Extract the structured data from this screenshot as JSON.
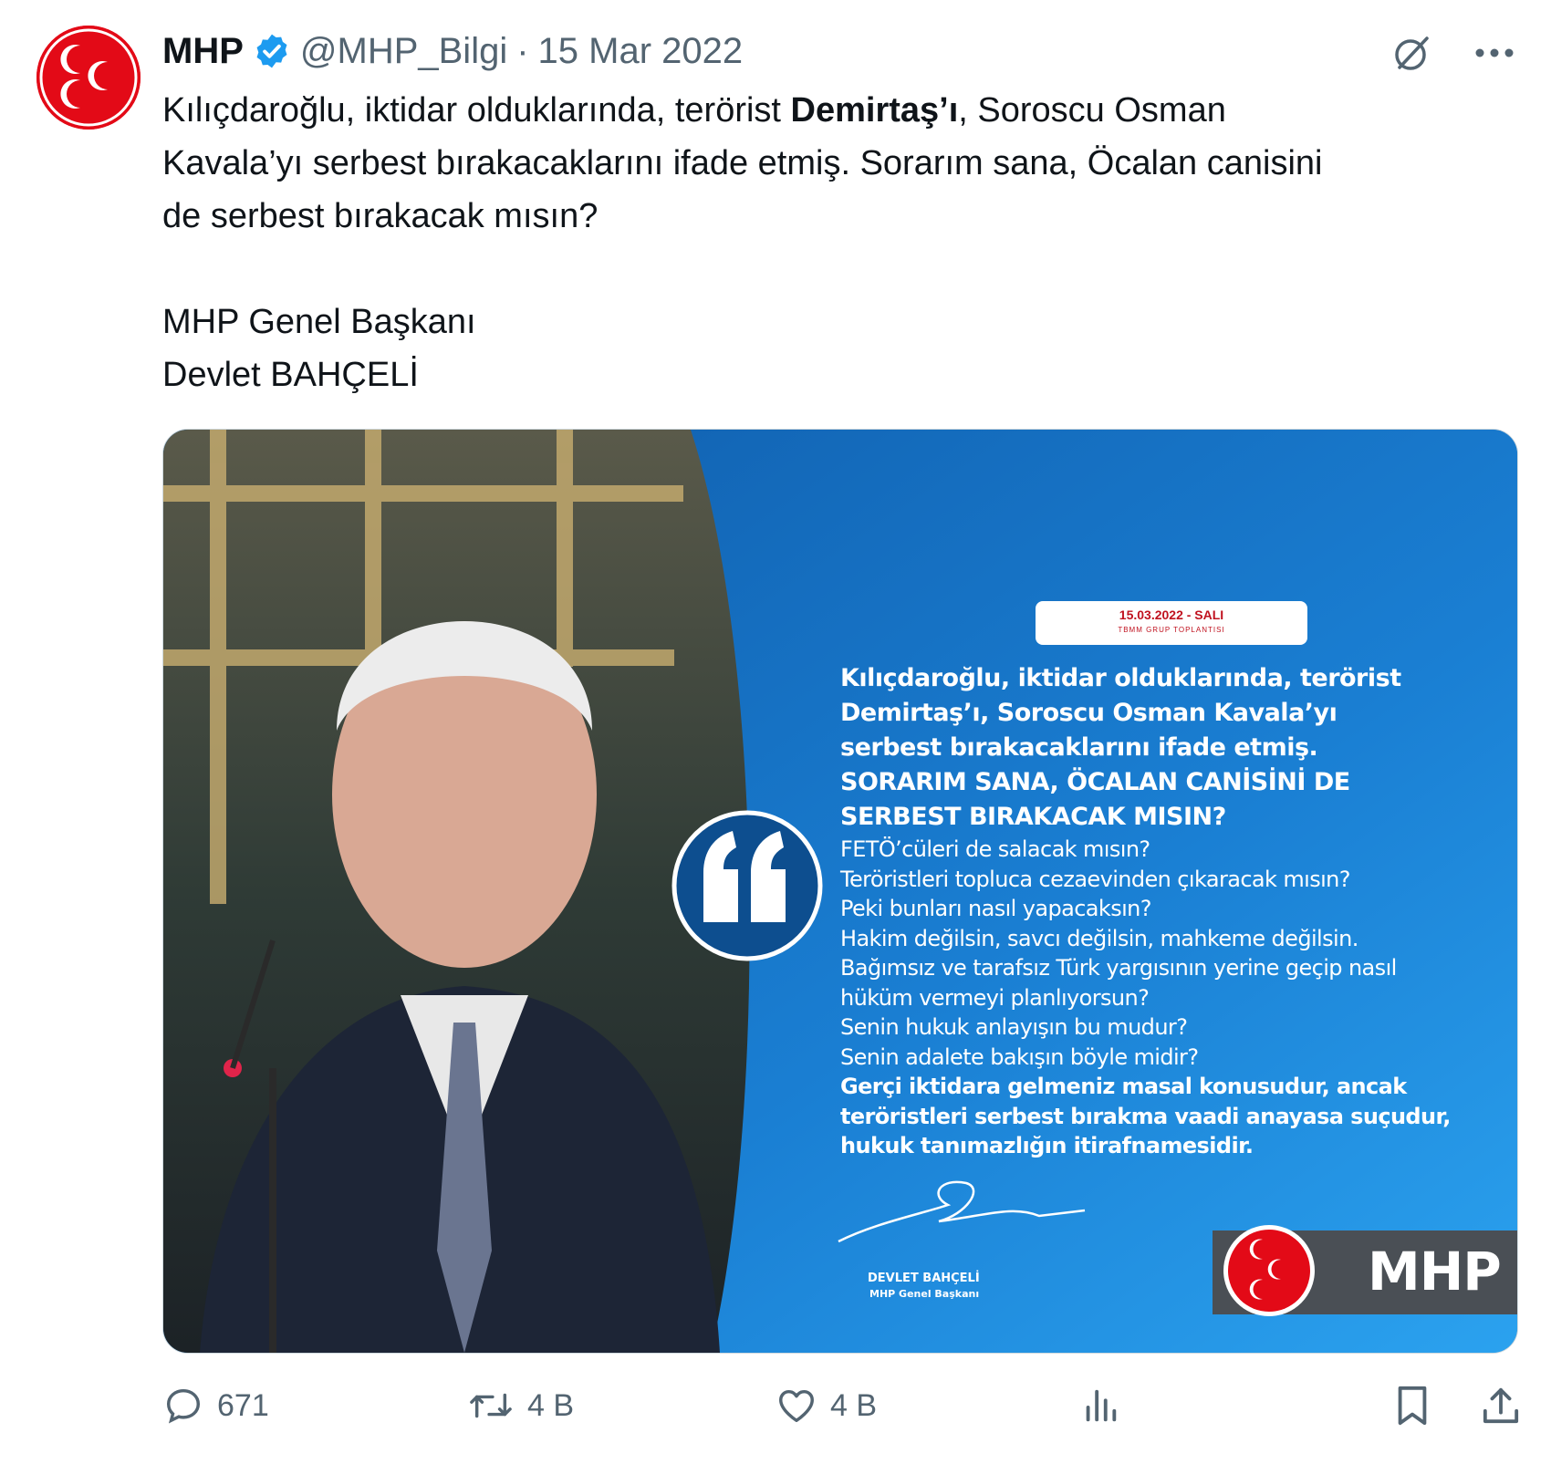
{
  "tweet": {
    "author_name": "MHP",
    "handle": "@MHP_Bilgi",
    "separator": "·",
    "date": "15 Mar 2022",
    "text_lines": [
      {
        "a": "Kılıçdaroğlu, iktidar olduklarında, terörist ",
        "b": "Demirtaş’ı",
        "c": ", Soroscu Osman"
      },
      "Kavala’yı serbest bırakacaklarını ifade etmiş. Sorarım sana, Öcalan canisini",
      "de serbest bırakacak mısın?"
    ],
    "signature_lines": [
      "MHP Genel Başkanı",
      "Devlet BAHÇELİ"
    ]
  },
  "media": {
    "date_pill": "15.03.2022 - SALI",
    "date_pill_sub": "TBMM GRUP TOPLANTISI",
    "quote_head": [
      "Kılıçdaroğlu, iktidar olduklarında, terörist",
      "Demirtaş’ı, Soroscu Osman Kavala’yı",
      "serbest bırakacaklarını ifade etmiş."
    ],
    "quote_caps": [
      "SORARIM SANA, ÖCALAN CANİSİNİ DE",
      "SERBEST BIRAKACAK MISIN?"
    ],
    "quote_body": [
      "FETÖ’cüleri de salacak mısın?",
      "Teröristleri topluca cezaevinden çıkaracak mısın?",
      "Peki bunları nasıl yapacaksın?",
      "Hakim değilsin, savcı değilsin, mahkeme değilsin.",
      "Bağımsız ve tarafsız Türk yargısının yerine geçip nasıl",
      "hüküm vermeyi planlıyorsun?",
      "Senin hukuk anlayışın bu mudur?",
      "Senin adalete bakışın böyle midir?"
    ],
    "quote_tail": [
      "Gerçi iktidara gelmeniz masal konusudur, ancak",
      "teröristleri serbest bırakma vaadi anayasa suçudur,",
      "hukuk tanımazlığın itirafnamesidir."
    ],
    "signature_name": "DEVLET BAHÇELİ",
    "signature_title": "MHP Genel Başkanı",
    "logo_text": "MHP"
  },
  "actions": {
    "replies": "671",
    "reposts": "4 B",
    "likes": "4 B"
  },
  "colors": {
    "brand_red": "#e30a17",
    "verified_blue": "#1d9bf0",
    "panel_blue": "#1a78c8",
    "muted": "#536471"
  },
  "icons": [
    "verified-badge-icon",
    "grok-icon",
    "more-icon",
    "reply-icon",
    "repost-icon",
    "like-icon",
    "views-icon",
    "bookmark-icon",
    "share-icon",
    "quote-mark-icon"
  ]
}
